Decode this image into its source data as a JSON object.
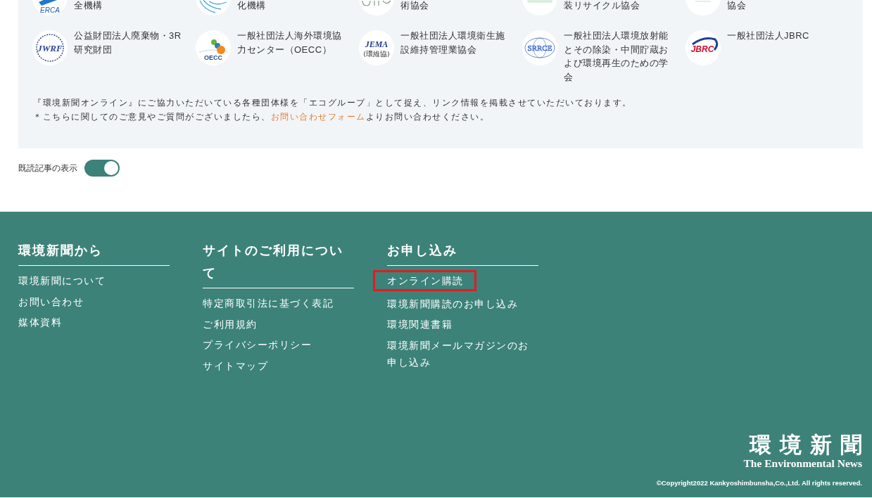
{
  "eco_groups": {
    "rows": [
      {
        "cut_off": true,
        "items": [
          {
            "kind": "swoosh",
            "logo_text": [
              "ERCA"
            ],
            "name": "全機構"
          },
          {
            "kind": "globe",
            "name": "化機構"
          },
          {
            "kind": "letters",
            "name": "術協会"
          },
          {
            "kind": "stripes",
            "name": "装リサイクル協会"
          },
          {
            "kind": "plain",
            "name": "協会"
          }
        ]
      },
      {
        "cut_off": false,
        "items": [
          {
            "kind": "gear-ring",
            "logo_text": [
              "JWRF"
            ],
            "name": "公益財団法人廃棄物・3R研究財団"
          },
          {
            "kind": "dots",
            "logo_text": [
              "OECC"
            ],
            "name": "一般社団法人海外環境協力センター（OECC）"
          },
          {
            "kind": "bold-italic",
            "logo_text": [
              "JEMA",
              "(環維協)"
            ],
            "name": "一般社団法人環境衛生施設維持管理業協会"
          },
          {
            "kind": "globe-lines",
            "logo_text": [
              "SRRCE"
            ],
            "name": "一般社団法人環境放射能とその除染・中間貯蔵および環境再生のための学会"
          },
          {
            "kind": "ring",
            "logo_text": [
              "JBRC"
            ],
            "name": "一般社団法人JBRC"
          }
        ]
      }
    ],
    "notes": [
      {
        "text": "『環境新聞オンライン』にご協力いただいている各種団体様を「エコグループ」として捉え、リンク情報を掲載させていただいております。"
      },
      {
        "text": "＊こちらに関してのご意見やご質問がございましたら、",
        "link": "お問い合わせフォーム",
        "after": "よりお問い合わせください。"
      }
    ]
  },
  "read_toggle": {
    "label": "既読記事の表示",
    "on": true
  },
  "footer": {
    "columns": [
      {
        "heading": "環境新聞から",
        "links": [
          {
            "label": "環境新聞について",
            "highlighted": false
          },
          {
            "label": "お問い合わせ",
            "highlighted": false
          },
          {
            "label": "媒体資料",
            "highlighted": false
          }
        ]
      },
      {
        "heading": "サイトのご利用について",
        "links": [
          {
            "label": "特定商取引法に基づく表記",
            "highlighted": false
          },
          {
            "label": "ご利用規約",
            "highlighted": false
          },
          {
            "label": "プライバシーポリシー",
            "highlighted": false
          },
          {
            "label": "サイトマップ",
            "highlighted": false
          }
        ]
      },
      {
        "heading": "お申し込み",
        "links": [
          {
            "label": "オンライン購読",
            "highlighted": true
          },
          {
            "label": "環境新聞購読のお申し込み",
            "highlighted": false
          },
          {
            "label": "環境関連書籍",
            "highlighted": false
          },
          {
            "label": "環境新聞メールマガジンのお申し込み",
            "highlighted": false
          }
        ]
      }
    ],
    "brand": {
      "title": "環境新聞",
      "subtitle": "The Environmental News"
    },
    "copyright": "©Copyright2022 Kankyoshimbunsha,Co.,Ltd. All rights reserved."
  }
}
